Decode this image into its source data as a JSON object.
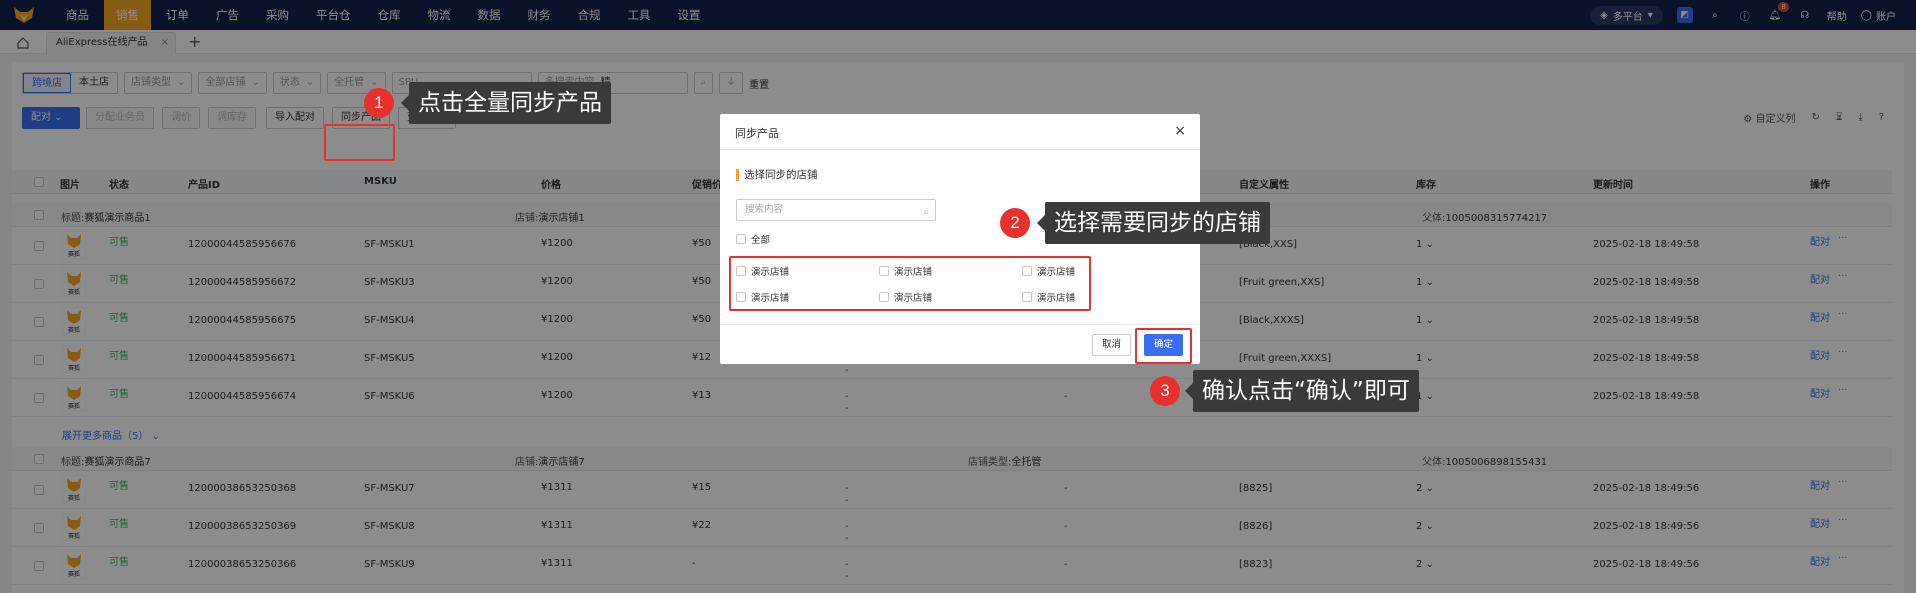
{
  "nav": {
    "items": [
      "商品",
      "销售",
      "订单",
      "广告",
      "采购",
      "平台仓",
      "仓库",
      "物流",
      "数据",
      "财务",
      "合规",
      "工具",
      "设置"
    ],
    "active_index": 1,
    "platform_label": "多平台",
    "notification_count": "8",
    "help_label": "帮助",
    "account_label": "账户"
  },
  "tabs": {
    "active_label": "AliExpress在线产品",
    "close": "×",
    "add": "+"
  },
  "filters": {
    "seg_a": "跨境店",
    "seg_b": "本土店",
    "shop_type": "店铺类型",
    "all_shops": "全部店铺",
    "status": "状态",
    "managed": "全托管",
    "spu_label": "SPU",
    "search_placeholder": "多搜索内容",
    "precise": "精",
    "reset": "重置"
  },
  "toolbar": {
    "pair": "配对",
    "assign": "分配业务员",
    "adjust_price": "调价",
    "adjust_stock": "调库存",
    "import_pair": "导入配对",
    "sync_products": "同步产品",
    "change_log": "变更记录",
    "custom_columns": "自定义列"
  },
  "table": {
    "headers": [
      "图片",
      "状态",
      "产品ID",
      "MSKU",
      "价格",
      "促销价",
      "自定义属性",
      "库存",
      "更新时间",
      "操作"
    ],
    "groups": [
      {
        "title_label": "标题:",
        "title": "赛狐演示商品1",
        "shop_label": "店铺:",
        "shop": "演示店铺1",
        "type_label": "",
        "type": "",
        "parent_label": "父体:",
        "parent": "1005008315774217"
      },
      {
        "title_label": "标题:",
        "title": "赛狐演示商品7",
        "shop_label": "店铺:",
        "shop": "演示店铺7",
        "type_label": "店铺类型:",
        "type": "全托管",
        "parent_label": "父体:",
        "parent": "1005006898155431"
      }
    ],
    "rows": [
      {
        "status": "可售",
        "id": "12000044585956676",
        "msku": "SF-MSKU1",
        "price": "¥1200",
        "promo": "¥50",
        "mid1": "",
        "mid2": "",
        "attr": "[Black,XXS]",
        "stock": "1",
        "time": "2025-02-18 18:49:58"
      },
      {
        "status": "可售",
        "id": "12000044585956672",
        "msku": "SF-MSKU3",
        "price": "¥1200",
        "promo": "¥50",
        "mid1": "",
        "mid2": "",
        "attr": "[Fruit green,XXS]",
        "stock": "1",
        "time": "2025-02-18 18:49:58"
      },
      {
        "status": "可售",
        "id": "12000044585956675",
        "msku": "SF-MSKU4",
        "price": "¥1200",
        "promo": "¥50",
        "mid1": "",
        "mid2": "",
        "attr": "[Black,XXXS]",
        "stock": "1",
        "time": "2025-02-18 18:49:58"
      },
      {
        "status": "可售",
        "id": "12000044585956671",
        "msku": "SF-MSKU5",
        "price": "¥1200",
        "promo": "¥12",
        "mid1": "",
        "mid2": "",
        "attr": "[Fruit green,XXXS]",
        "stock": "1",
        "time": "2025-02-18 18:49:58"
      },
      {
        "status": "可售",
        "id": "12000044585956674",
        "msku": "SF-MSKU6",
        "price": "¥1200",
        "promo": "¥13",
        "mid1": "-",
        "mid2": "-",
        "attr": "",
        "stock": "1",
        "time": "2025-02-18 18:49:58"
      },
      {
        "status": "可售",
        "id": "12000038653250368",
        "msku": "SF-MSKU7",
        "price": "¥1311",
        "promo": "¥15",
        "mid1": "-",
        "mid2": "-",
        "attr": "[8825]",
        "stock": "2",
        "time": "2025-02-18 18:49:56"
      },
      {
        "status": "可售",
        "id": "12000038653250369",
        "msku": "SF-MSKU8",
        "price": "¥1311",
        "promo": "¥22",
        "mid1": "-",
        "mid2": "-",
        "attr": "[8826]",
        "stock": "2",
        "time": "2025-02-18 18:49:56"
      },
      {
        "status": "可售",
        "id": "12000038653250366",
        "msku": "SF-MSKU9",
        "price": "¥1311",
        "promo": "-",
        "mid1": "-",
        "mid2": "-",
        "attr": "[8823]",
        "stock": "2",
        "time": "2025-02-18 18:49:56"
      }
    ],
    "row_dash": "-",
    "action_label": "配对",
    "more": "···",
    "thumb_caption": "赛狐",
    "expand_more": "展开更多商品（5）"
  },
  "modal": {
    "title": "同步产品",
    "close": "×",
    "section": "选择同步的店铺",
    "search_placeholder": "搜索内容",
    "all_label": "全部",
    "shops": [
      "演示店铺",
      "演示店铺",
      "演示店铺",
      "演示店铺",
      "演示店铺",
      "演示店铺"
    ],
    "cancel": "取消",
    "confirm": "确定"
  },
  "callouts": {
    "step1": {
      "num": "1",
      "text": "点击全量同步产品"
    },
    "step2": {
      "num": "2",
      "text": "选择需要同步的店铺"
    },
    "step3": {
      "num": "3",
      "text": "确认点击“确认”即可"
    }
  },
  "colors": {
    "nav_bg": "#13214b",
    "accent": "#f5a623",
    "primary": "#3a6df0",
    "callout_red": "#e8302f",
    "success": "#3fb36b"
  }
}
